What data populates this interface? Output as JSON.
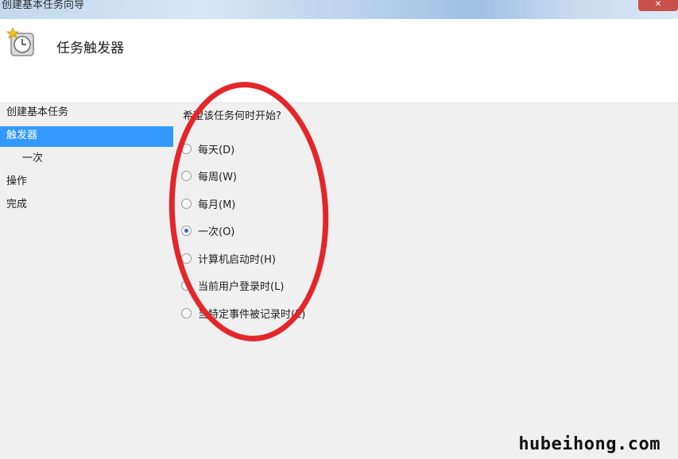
{
  "window": {
    "title": "创建基本任务向导",
    "close_label": "✕"
  },
  "header": {
    "title": "任务触发器",
    "icon": "clock-icon"
  },
  "nav": {
    "items": [
      {
        "label": "创建基本任务",
        "active": false,
        "sub": false
      },
      {
        "label": "触发器",
        "active": true,
        "sub": false
      },
      {
        "label": "一次",
        "active": false,
        "sub": true
      },
      {
        "label": "操作",
        "active": false,
        "sub": false
      },
      {
        "label": "完成",
        "active": false,
        "sub": false
      }
    ]
  },
  "main": {
    "question": "希望该任务何时开始?",
    "options": [
      {
        "label": "每天(D)",
        "checked": false
      },
      {
        "label": "每周(W)",
        "checked": false
      },
      {
        "label": "每月(M)",
        "checked": false
      },
      {
        "label": "一次(O)",
        "checked": true
      },
      {
        "label": "计算机启动时(H)",
        "checked": false
      },
      {
        "label": "当前用户登录时(L)",
        "checked": false
      },
      {
        "label": "当特定事件被记录时(E)",
        "checked": false
      }
    ]
  },
  "annotation": {
    "color": "#e4262a"
  },
  "watermark": "hubeihong.com"
}
